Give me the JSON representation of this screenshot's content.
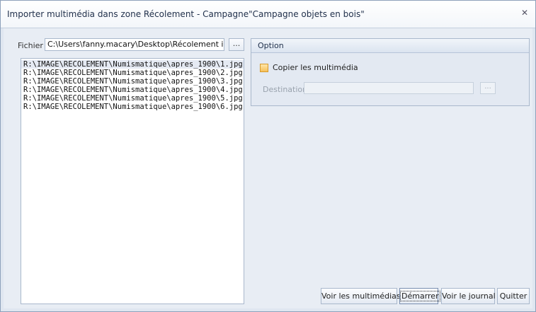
{
  "window": {
    "title": "Importer multimédia dans zone Récolement - Campagne\"Campagne objets en bois\"",
    "close_glyph": "✕"
  },
  "file": {
    "label": "Fichier",
    "value": "C:\\Users\\fanny.macary\\Desktop\\Récolement image",
    "browse_label": "..."
  },
  "file_list": [
    "R:\\IMAGE\\RECOLEMENT\\Numismatique\\apres_1900\\1.jpg",
    "R:\\IMAGE\\RECOLEMENT\\Numismatique\\apres_1900\\2.jpg",
    "R:\\IMAGE\\RECOLEMENT\\Numismatique\\apres_1900\\3.jpg",
    "R:\\IMAGE\\RECOLEMENT\\Numismatique\\apres_1900\\4.jpg",
    "R:\\IMAGE\\RECOLEMENT\\Numismatique\\apres_1900\\5.jpg",
    "R:\\IMAGE\\RECOLEMENT\\Numismatique\\apres_1900\\6.jpg"
  ],
  "option": {
    "header": "Option",
    "copy_label": "Copier les multimédia",
    "copy_checked": false,
    "destination_label": "Destination",
    "destination_value": "",
    "destination_browse": "..."
  },
  "buttons": {
    "voir": "Voir les multimédias",
    "demarrer": "Démarrer",
    "journal": "Voir le journal",
    "quitter": "Quitter"
  }
}
